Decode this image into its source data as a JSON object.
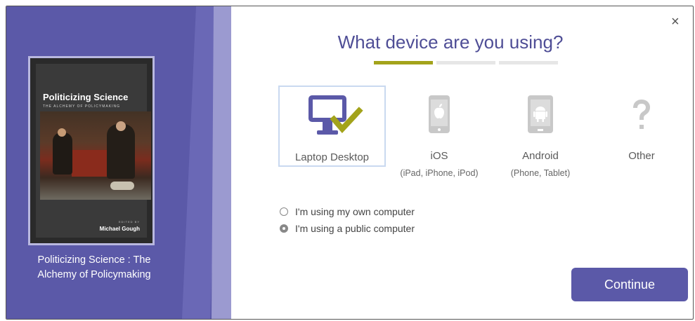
{
  "book": {
    "cover_title": "Politicizing Science",
    "cover_subtitle": "THE ALCHEMY OF POLICYMAKING",
    "cover_editor_label": "EDITED BY",
    "cover_author": "Michael Gough",
    "caption": "Politicizing Science : The Alchemy of Policymaking"
  },
  "dialog": {
    "close_label": "×",
    "heading": "What device are you using?",
    "progress": {
      "steps": 3,
      "current": 1
    },
    "devices": [
      {
        "label": "Laptop Desktop",
        "sub": "",
        "icon": "laptop-desktop-check-icon",
        "selected": true
      },
      {
        "label": "iOS",
        "sub": "(iPad, iPhone, iPod)",
        "icon": "ios-tablet-icon",
        "selected": false
      },
      {
        "label": "Android",
        "sub": "(Phone, Tablet)",
        "icon": "android-tablet-icon",
        "selected": false
      },
      {
        "label": "Other",
        "sub": "",
        "icon": "question-mark-icon",
        "selected": false
      }
    ],
    "radio_options": [
      {
        "label": "I'm using my own computer",
        "checked": false
      },
      {
        "label": "I'm using a public computer",
        "checked": true
      }
    ],
    "continue_label": "Continue"
  },
  "colors": {
    "brand_purple": "#5b59a8",
    "accent_olive": "#a3a31b",
    "device_icon_gray": "#c8c8c8",
    "monitor_purple": "#5b59a8",
    "check_olive": "#a3a31b"
  }
}
